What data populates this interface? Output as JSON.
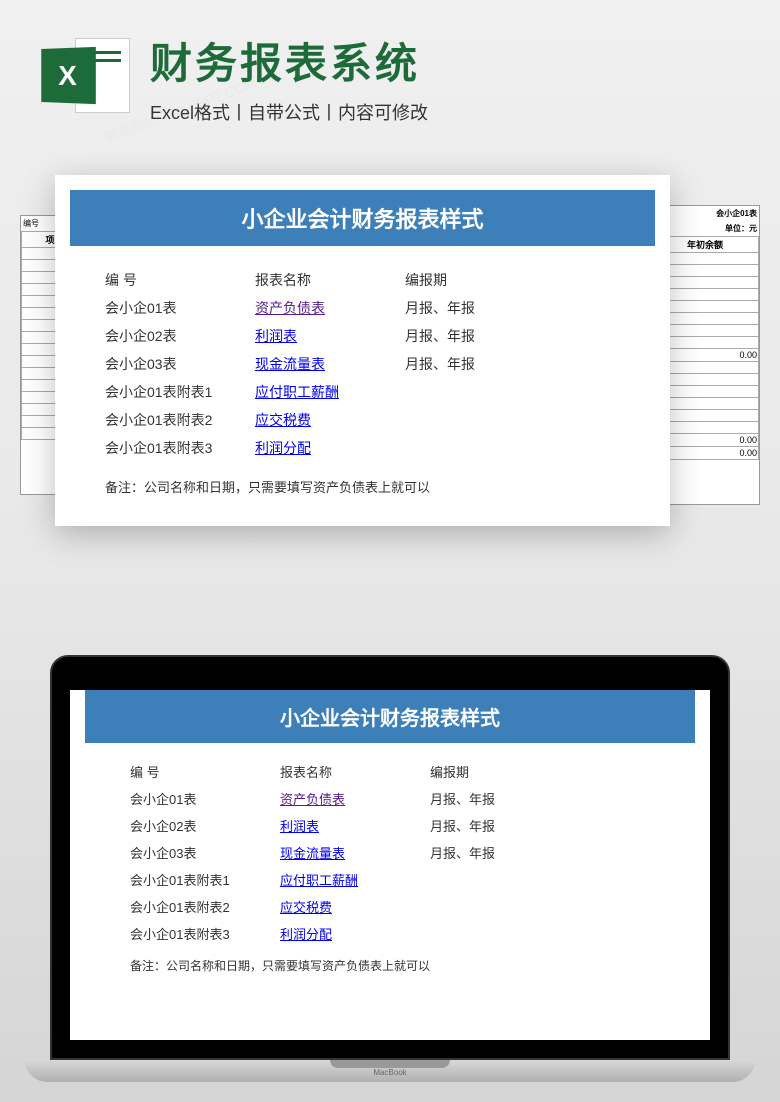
{
  "header": {
    "icon_letter": "X",
    "main_title": "财务报表系统",
    "subtitle": "Excel格式丨自带公式丨内容可修改"
  },
  "card": {
    "title": "小企业会计财务报表样式",
    "columns": {
      "num": "编  号",
      "name": "报表名称",
      "period": "编报期"
    },
    "rows": [
      {
        "num": "会小企01表",
        "name": "资产负债表",
        "period": "月报、年报",
        "link_style": "visited"
      },
      {
        "num": "会小企02表",
        "name": "利润表",
        "period": "月报、年报",
        "link_style": "link"
      },
      {
        "num": "会小企03表",
        "name": "现金流量表",
        "period": "月报、年报",
        "link_style": "link"
      },
      {
        "num": "会小企01表附表1",
        "name": "应付职工薪酬",
        "period": "",
        "link_style": "link"
      },
      {
        "num": "会小企01表附表2",
        "name": "应交税费",
        "period": "",
        "link_style": "link"
      },
      {
        "num": "会小企01表附表3",
        "name": "利润分配",
        "period": "",
        "link_style": "link"
      }
    ],
    "note": "备注：公司名称和日期，只需要填写资产负债表上就可以"
  },
  "back_sheets": {
    "left_header": "编号",
    "left_col": "项",
    "right_title": "会小企01表",
    "right_unit": "单位：元",
    "right_col": "年初余额",
    "right_vals": [
      "0.00",
      "0.00",
      "0.00"
    ]
  },
  "laptop": {
    "brand": "MacBook"
  }
}
